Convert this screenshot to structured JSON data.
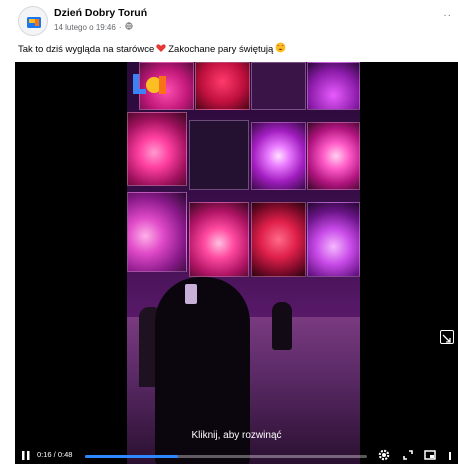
{
  "post": {
    "author": "Dzień Dobry Toruń",
    "date": "14 lutego o 19:46",
    "caption_part1": "Tak to dziś wygląda na starówce",
    "caption_part2": "Zakochane pary świętują"
  },
  "video": {
    "subtitle": "Kliknij, aby rozwinąć",
    "time": "0:16 / 0:48",
    "progress": 0.33
  },
  "icons": [
    "globe-icon",
    "heart-emoji",
    "heart-eyes-emoji",
    "play-pause-icon",
    "settings-icon",
    "fullscreen-icon",
    "pip-icon",
    "more-icon",
    "expand-icon"
  ],
  "colors": {
    "accent": "#2d88ff",
    "text": "#050505",
    "muted": "#65676b"
  }
}
